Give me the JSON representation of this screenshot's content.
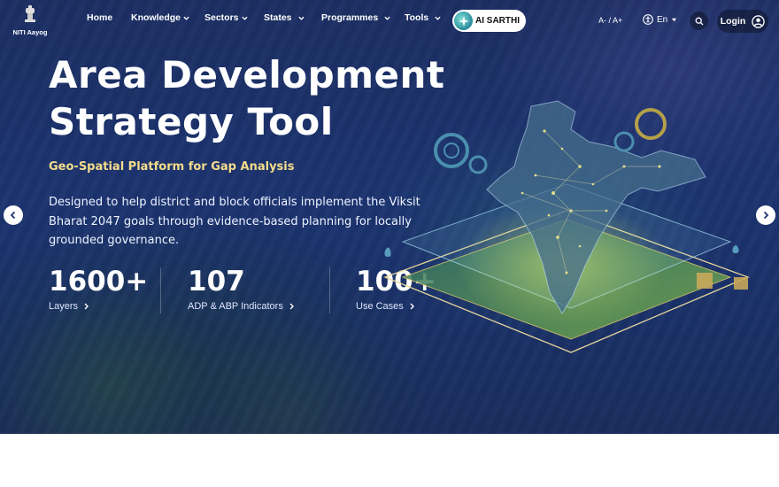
{
  "brand": {
    "logo_text": "NITI Aayog"
  },
  "nav": {
    "home": "Home",
    "knowledge": "Knowledge",
    "sectors": "Sectors",
    "states": "States",
    "programmes": "Programmes",
    "tools": "Tools",
    "ai_button": "AI SARTHI",
    "font_size": "A- / A+",
    "language": "En",
    "login": "Login"
  },
  "hero": {
    "title": "Area Development Strategy Tool",
    "subtitle": "Geo-Spatial Platform for Gap Analysis",
    "description": "Designed to help district and block officials implement the Viksit Bharat 2047 goals through evidence-based planning for locally grounded governance."
  },
  "stats": [
    {
      "value": "1600+",
      "label": "Layers"
    },
    {
      "value": "107",
      "label": "ADP & ABP Indicators"
    },
    {
      "value": "100+",
      "label": "Use Cases"
    }
  ],
  "colors": {
    "hero_bg": "#1c3470",
    "subtitle": "#f4dc8a",
    "ai_accent": "#2a8b9c"
  },
  "icons": [
    "emblem-icon",
    "chevron-down-icon",
    "sparkle-icon",
    "accessibility-icon",
    "search-icon",
    "user-icon",
    "chevron-right-icon",
    "chevron-left-icon"
  ]
}
